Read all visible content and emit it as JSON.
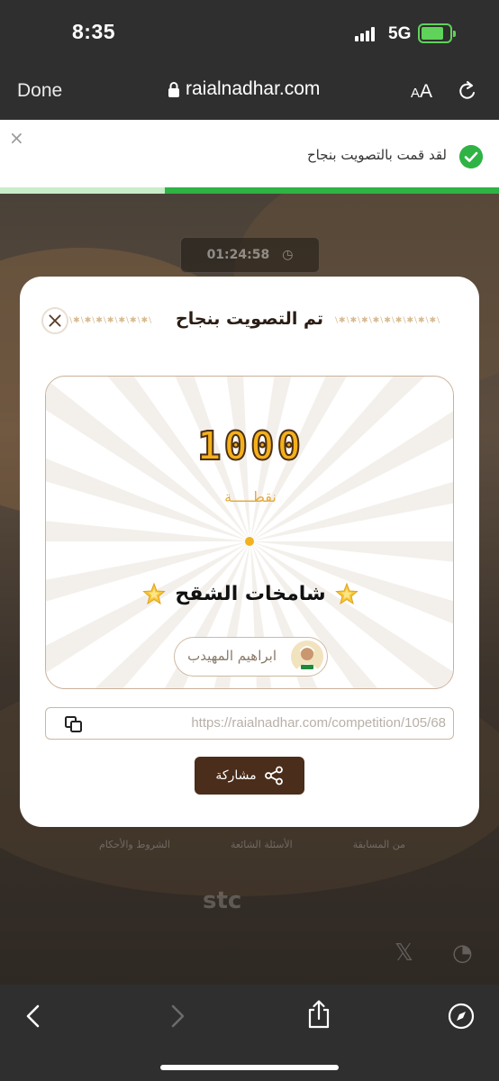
{
  "status_bar": {
    "time": "8:35",
    "network": "5G",
    "battery_level": 0.8
  },
  "browser": {
    "done_label": "Done",
    "url": "raialnadhar.com",
    "text_size_small": "A",
    "text_size_big": "A"
  },
  "toast": {
    "message": "لقد قمت بالتصويت بنجاح",
    "close_symbol": "×",
    "progress_fraction": 0.67
  },
  "background": {
    "timer": "01:24:58",
    "footer_links": [
      "من المسابقة",
      "الأسئلة الشائعة",
      "الشروط والأحكام"
    ],
    "logos": [
      "stc"
    ]
  },
  "modal": {
    "title": "تم التصويت بنجاح",
    "points_value": "1000",
    "points_unit": "نقطـــــة",
    "team_name": "شامخات الشقح",
    "player_name": "ابراهيم المهيدب",
    "share_link": "https://raialnadhar.com/competition/105/68",
    "share_label": "مشاركة"
  },
  "icons": {
    "toast_check": "check-circle-icon",
    "close": "close-icon",
    "copy": "copy-icon",
    "share": "share-icon",
    "star": "star-icon"
  },
  "colors": {
    "accent_brown": "#4a2d1a",
    "points_gold": "#f4b01b",
    "success_green": "#2fb344"
  }
}
